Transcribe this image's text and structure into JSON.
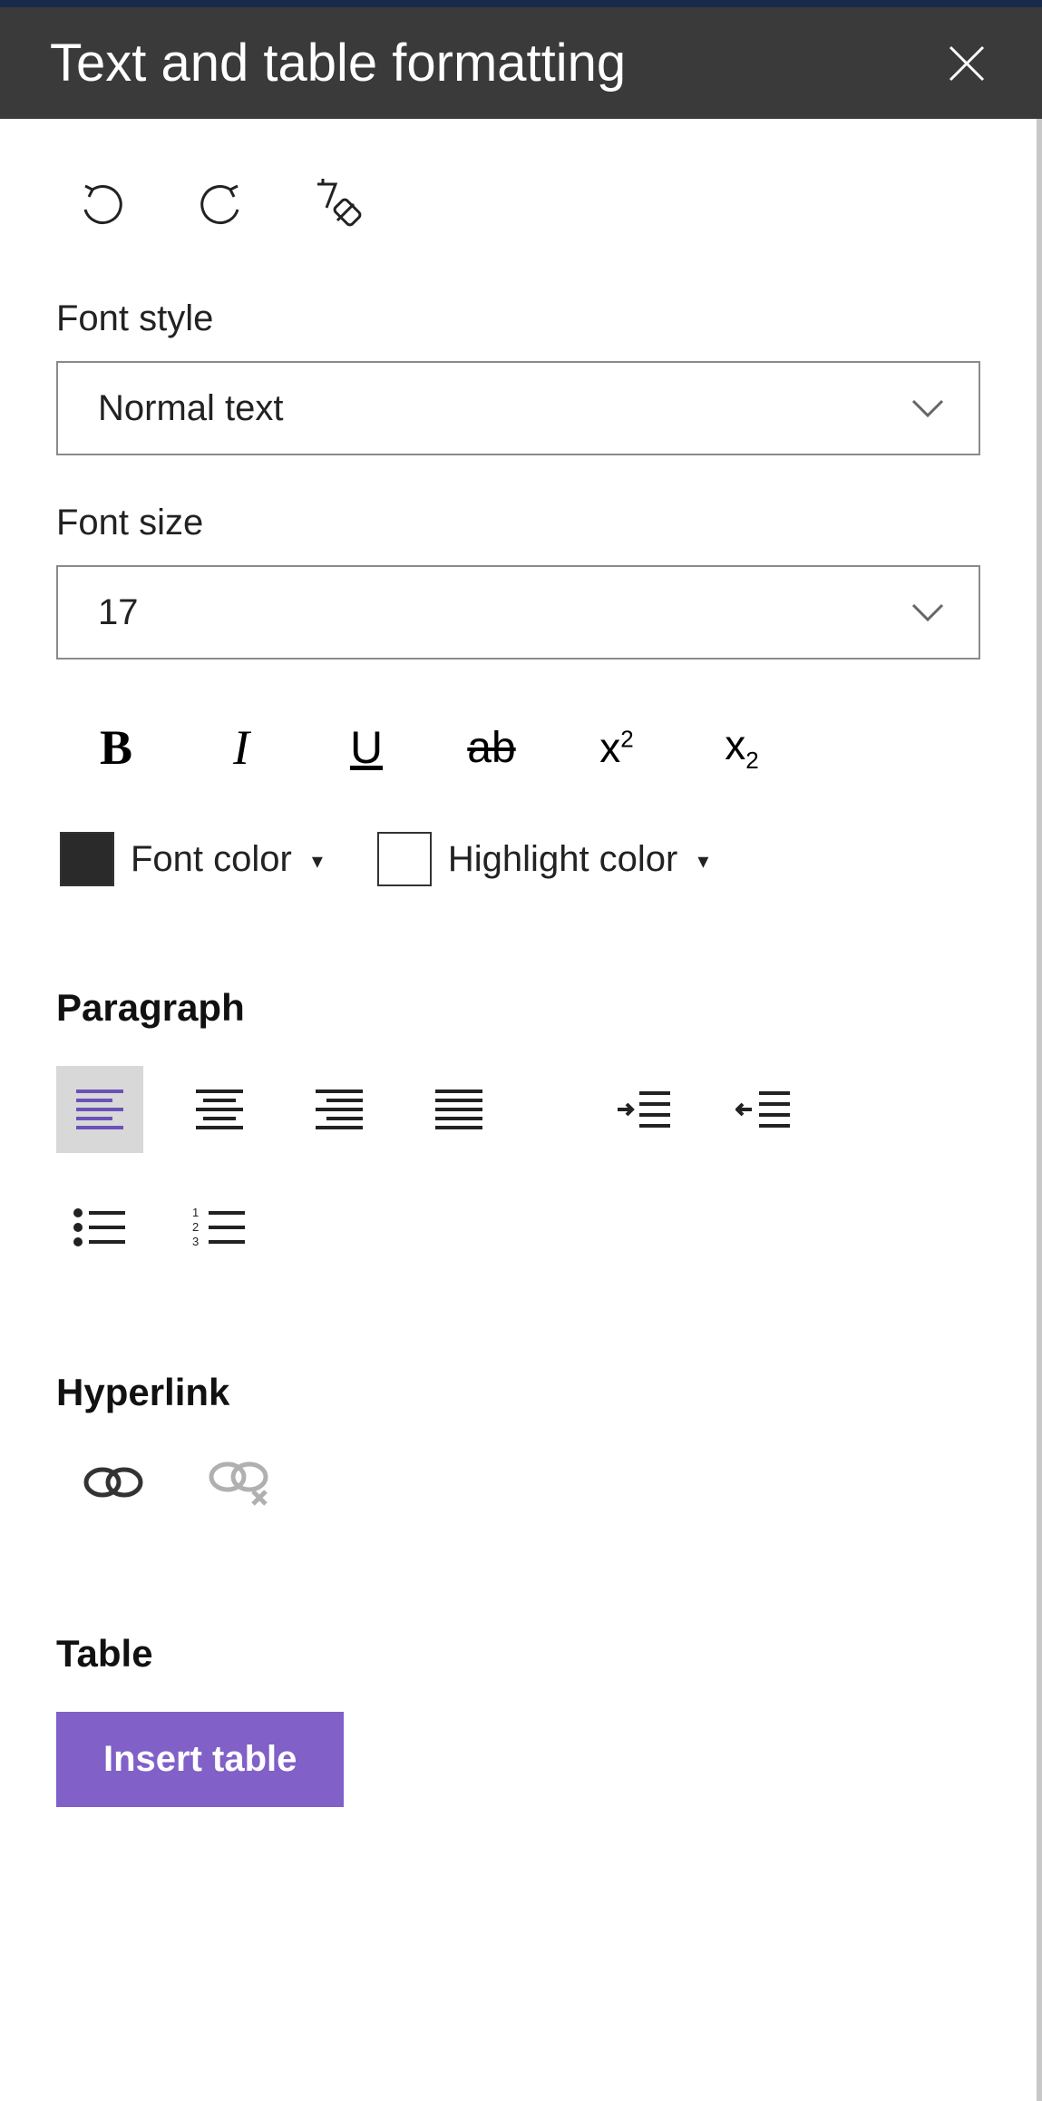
{
  "header": {
    "title": "Text and table formatting"
  },
  "fontStyle": {
    "label": "Font style",
    "value": "Normal text"
  },
  "fontSize": {
    "label": "Font size",
    "value": "17"
  },
  "colors": {
    "fontColorLabel": "Font color",
    "fontColorSwatch": "#2a2a2a",
    "highlightLabel": "Highlight color",
    "highlightSwatch": "#ffffff"
  },
  "sections": {
    "paragraph": "Paragraph",
    "hyperlink": "Hyperlink",
    "table": "Table"
  },
  "buttons": {
    "insertTable": "Insert table"
  }
}
